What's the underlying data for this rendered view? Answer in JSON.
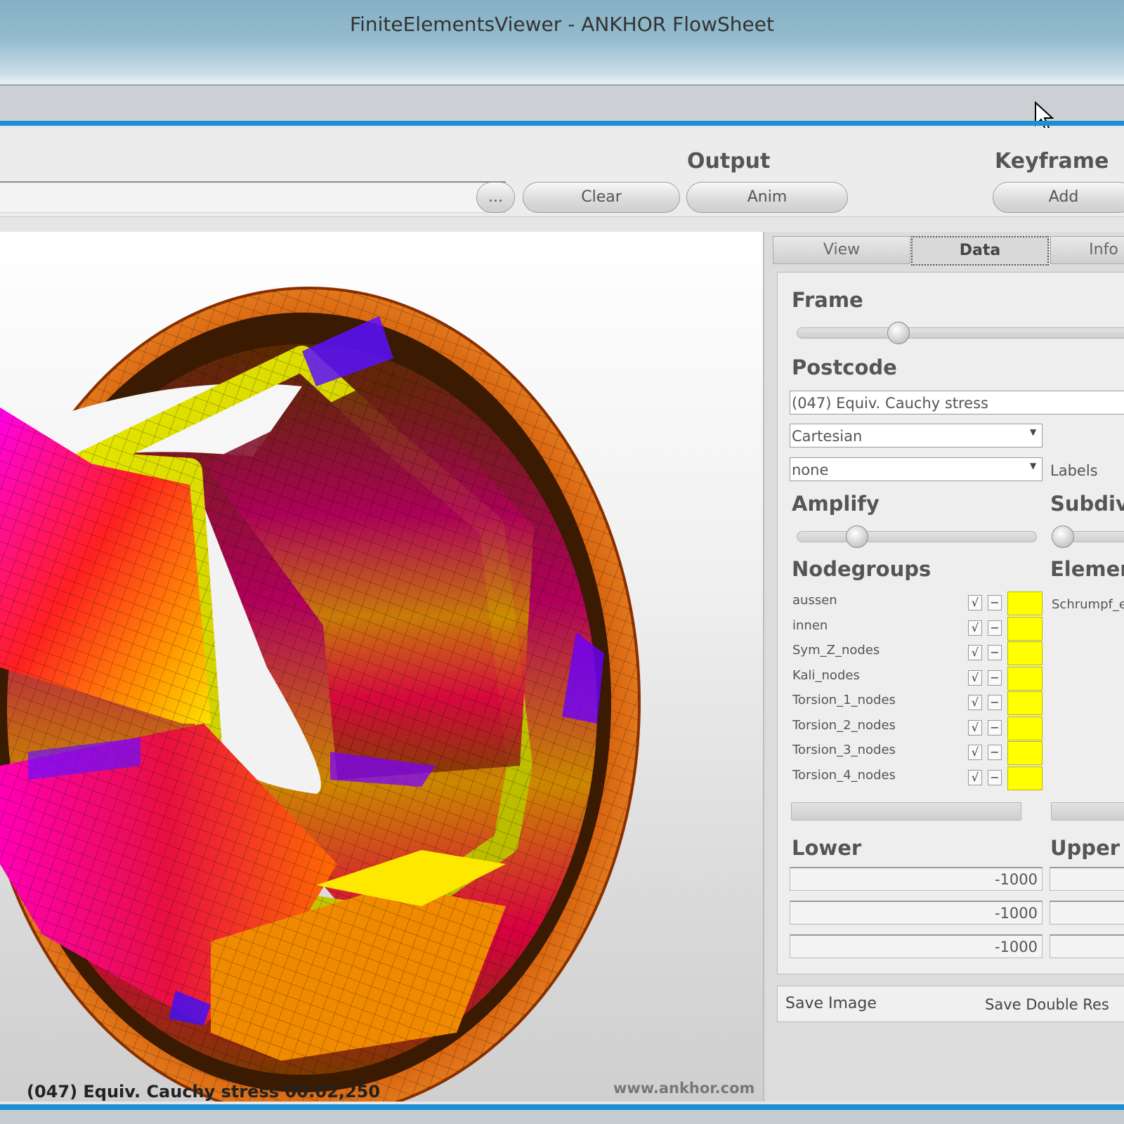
{
  "window": {
    "title": "FiniteElementsViewer - ANKHOR FlowSheet"
  },
  "toolbar": {
    "browse_label": "...",
    "output_title": "Output",
    "clear_label": "Clear",
    "anim_label": "Anim",
    "keyframe_title": "Keyframe",
    "add_label": "Add"
  },
  "viewport": {
    "caption": "(047) Equiv. Cauchy stress 00:02,250",
    "watermark": "www.ankhor.com"
  },
  "tabs": [
    {
      "label": "View",
      "active": false
    },
    {
      "label": "Data",
      "active": true
    },
    {
      "label": "Info",
      "active": false
    }
  ],
  "panel": {
    "frame_title": "Frame",
    "frame_value": 0.3,
    "postcode_title": "Postcode",
    "postcode_value": "(047) Equiv. Cauchy stress",
    "coord_value": "Cartesian",
    "labels_value": "none",
    "labels_text": "Labels",
    "amplify_title": "Amplify",
    "amplify_value": 0.25,
    "subdiv_title": "Subdivi",
    "nodegroups_title": "Nodegroups",
    "elements_title": "Elemen",
    "nodegroups": [
      {
        "name": "aussen",
        "checked": "√",
        "minus": "−"
      },
      {
        "name": "innen",
        "checked": "√",
        "minus": "−"
      },
      {
        "name": "Sym_Z_nodes",
        "checked": "√",
        "minus": "−"
      },
      {
        "name": "Kali_nodes",
        "checked": "√",
        "minus": "−"
      },
      {
        "name": "Torsion_1_nodes",
        "checked": "√",
        "minus": "−"
      },
      {
        "name": "Torsion_2_nodes",
        "checked": "√",
        "minus": "−"
      },
      {
        "name": "Torsion_3_nodes",
        "checked": "√",
        "minus": "−"
      },
      {
        "name": "Torsion_4_nodes",
        "checked": "√",
        "minus": "−"
      }
    ],
    "swatch_color": "#ffff00",
    "elements": [
      "Schrumpf_ele"
    ],
    "lower_title": "Lower",
    "upper_title": "Upper",
    "lower_values": [
      "-1000",
      "-1000",
      "-1000"
    ],
    "save_image": "Save Image",
    "save_double": "Save Double Res"
  },
  "colors": {
    "accent_blue": "#1a8fd6",
    "title_bar": "#93bbcd"
  }
}
